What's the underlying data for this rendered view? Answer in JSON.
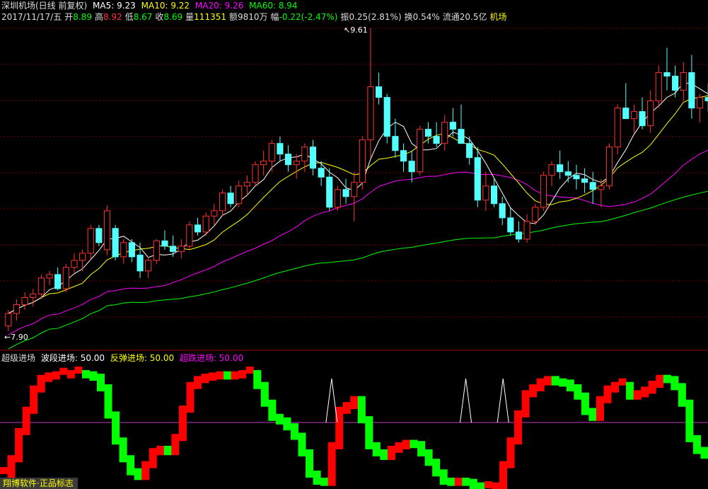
{
  "header": {
    "stock_name": "深圳机场(日线 前复权)",
    "ma5": "MA5: 9.23",
    "ma10": "MA10: 9.22",
    "ma20": "MA20: 9.26",
    "ma60": "MA60: 8.94",
    "date": "2017/11/17/五",
    "open_label": "开",
    "open": "8.89",
    "high_label": "高",
    "high": "8.92",
    "low_label": "低",
    "low": "8.67",
    "close_label": "收",
    "close": "8.69",
    "volume_label": "量",
    "volume": "111351",
    "amount_label": "额",
    "amount": "9810万",
    "change_label": "幅",
    "change": "-0.22(-2.47%)",
    "amplitude": "振0.25(2.81%)",
    "turnover": "换0.54%",
    "float_cap": "流通20.5亿",
    "sector": "机场"
  },
  "markers": {
    "high_mark": "9.61",
    "low_mark": "7.90"
  },
  "indicator": {
    "name": "超级进场",
    "wave_label": "波段进场: 50.00",
    "rebound_label": "反弹进场: 50.00",
    "superfall_label": "超跌进场: 50.00"
  },
  "brand": "翔博软件·正品标志",
  "colors": {
    "up": "#ff3232",
    "down": "#54ffff",
    "ma5": "#ffffff",
    "ma10": "#ffff00",
    "ma20": "#ff00ff",
    "ma60": "#00ff00",
    "ind_up": "#ff0000",
    "ind_down": "#00ff00"
  },
  "chart_data": {
    "type": "candlestick",
    "ylim": [
      7.9,
      9.61
    ],
    "candles": [
      [
        7.93,
        8.02,
        7.9,
        8.0
      ],
      [
        8.0,
        8.08,
        7.96,
        8.05
      ],
      [
        8.05,
        8.12,
        8.02,
        8.09
      ],
      [
        8.09,
        8.14,
        8.04,
        8.11
      ],
      [
        8.11,
        8.22,
        8.08,
        8.2
      ],
      [
        8.2,
        8.24,
        8.16,
        8.22
      ],
      [
        8.22,
        8.26,
        8.13,
        8.14
      ],
      [
        8.14,
        8.28,
        8.12,
        8.26
      ],
      [
        8.26,
        8.34,
        8.22,
        8.3
      ],
      [
        8.3,
        8.36,
        8.24,
        8.34
      ],
      [
        8.34,
        8.5,
        8.3,
        8.48
      ],
      [
        8.48,
        8.5,
        8.38,
        8.4
      ],
      [
        8.36,
        8.61,
        8.33,
        8.58
      ],
      [
        8.48,
        8.5,
        8.3,
        8.32
      ],
      [
        8.32,
        8.42,
        8.28,
        8.4
      ],
      [
        8.4,
        8.42,
        8.29,
        8.32
      ],
      [
        8.33,
        8.4,
        8.2,
        8.24
      ],
      [
        8.24,
        8.32,
        8.2,
        8.3
      ],
      [
        8.3,
        8.42,
        8.28,
        8.41
      ],
      [
        8.41,
        8.47,
        8.36,
        8.38
      ],
      [
        8.38,
        8.44,
        8.32,
        8.35
      ],
      [
        8.35,
        8.42,
        8.31,
        8.38
      ],
      [
        8.38,
        8.52,
        8.36,
        8.5
      ],
      [
        8.5,
        8.54,
        8.44,
        8.46
      ],
      [
        8.46,
        8.57,
        8.44,
        8.55
      ],
      [
        8.55,
        8.62,
        8.5,
        8.58
      ],
      [
        8.58,
        8.7,
        8.55,
        8.68
      ],
      [
        8.68,
        8.72,
        8.6,
        8.62
      ],
      [
        8.62,
        8.75,
        8.6,
        8.72
      ],
      [
        8.72,
        8.78,
        8.66,
        8.74
      ],
      [
        8.74,
        8.86,
        8.72,
        8.84
      ],
      [
        8.84,
        8.92,
        8.78,
        8.86
      ],
      [
        8.86,
        8.98,
        8.8,
        8.96
      ],
      [
        8.96,
        9.0,
        8.86,
        8.9
      ],
      [
        8.9,
        8.95,
        8.8,
        8.84
      ],
      [
        8.84,
        8.9,
        8.76,
        8.86
      ],
      [
        8.86,
        8.96,
        8.8,
        8.94
      ],
      [
        8.94,
        8.98,
        8.78,
        8.82
      ],
      [
        8.82,
        8.86,
        8.72,
        8.77
      ],
      [
        8.77,
        8.82,
        8.58,
        8.6
      ],
      [
        8.6,
        8.72,
        8.58,
        8.7
      ],
      [
        8.7,
        8.76,
        8.62,
        8.66
      ],
      [
        8.66,
        8.8,
        8.52,
        8.74
      ],
      [
        8.74,
        9.0,
        8.7,
        8.98
      ],
      [
        8.98,
        9.61,
        8.88,
        9.28
      ],
      [
        9.28,
        9.36,
        9.18,
        9.22
      ],
      [
        9.22,
        9.24,
        8.96,
        9.0
      ],
      [
        9.0,
        9.1,
        8.88,
        8.92
      ],
      [
        8.92,
        8.96,
        8.8,
        8.86
      ],
      [
        8.86,
        8.92,
        8.74,
        8.8
      ],
      [
        8.8,
        9.06,
        8.78,
        9.04
      ],
      [
        9.04,
        9.08,
        8.96,
        9.0
      ],
      [
        9.0,
        9.08,
        8.94,
        8.96
      ],
      [
        8.96,
        9.12,
        8.92,
        9.08
      ],
      [
        9.08,
        9.16,
        9.0,
        9.04
      ],
      [
        9.04,
        9.18,
        9.0,
        8.96
      ],
      [
        8.96,
        9.0,
        8.84,
        8.88
      ],
      [
        8.88,
        8.94,
        8.6,
        8.64
      ],
      [
        8.64,
        8.8,
        8.58,
        8.72
      ],
      [
        8.72,
        8.76,
        8.6,
        8.62
      ],
      [
        8.62,
        8.66,
        8.5,
        8.54
      ],
      [
        8.54,
        8.6,
        8.44,
        8.46
      ],
      [
        8.46,
        8.52,
        8.4,
        8.42
      ],
      [
        8.42,
        8.56,
        8.4,
        8.52
      ],
      [
        8.52,
        8.62,
        8.5,
        8.6
      ],
      [
        8.6,
        8.8,
        8.58,
        8.78
      ],
      [
        8.78,
        8.86,
        8.72,
        8.84
      ],
      [
        8.84,
        8.92,
        8.76,
        8.8
      ],
      [
        8.8,
        8.86,
        8.74,
        8.78
      ],
      [
        8.78,
        8.84,
        8.7,
        8.76
      ],
      [
        8.76,
        8.82,
        8.68,
        8.74
      ],
      [
        8.74,
        8.8,
        8.62,
        8.7
      ],
      [
        8.7,
        8.76,
        8.6,
        8.72
      ],
      [
        8.72,
        8.96,
        8.7,
        8.94
      ],
      [
        8.94,
        9.18,
        8.9,
        9.16
      ],
      [
        9.16,
        9.3,
        9.1,
        9.1
      ],
      [
        9.1,
        9.18,
        9.02,
        9.14
      ],
      [
        9.14,
        9.22,
        9.04,
        9.06
      ],
      [
        9.06,
        9.26,
        9.02,
        9.2
      ],
      [
        9.2,
        9.4,
        9.16,
        9.36
      ],
      [
        9.36,
        9.5,
        9.26,
        9.34
      ],
      [
        9.34,
        9.4,
        9.22,
        9.26
      ],
      [
        9.26,
        9.42,
        9.2,
        9.36
      ],
      [
        9.36,
        9.46,
        9.1,
        9.16
      ],
      [
        9.16,
        9.24,
        9.08,
        9.22
      ],
      [
        9.22,
        9.3,
        9.14,
        9.2
      ]
    ],
    "indicator": [
      0.12,
      0.25,
      0.48,
      0.66,
      0.84,
      0.93,
      0.95,
      0.96,
      0.96,
      0.97,
      0.97,
      0.96,
      0.94,
      0.85,
      0.62,
      0.4,
      0.25,
      0.14,
      0.1,
      0.2,
      0.31,
      0.33,
      0.31,
      0.43,
      0.67,
      0.87,
      0.92,
      0.94,
      0.95,
      0.96,
      0.95,
      0.96,
      0.97,
      0.97,
      0.87,
      0.72,
      0.6,
      0.57,
      0.52,
      0.44,
      0.3,
      0.12,
      0.06,
      0.05,
      0.36,
      0.66,
      0.7,
      0.75,
      0.58,
      0.36,
      0.3,
      0.27,
      0.33,
      0.36,
      0.38,
      0.37,
      0.3,
      0.22,
      0.13,
      0.06,
      0.05,
      0.06,
      0.05,
      0.02,
      0.0,
      0.0,
      0.02,
      0.2,
      0.4,
      0.63,
      0.8,
      0.85,
      0.9,
      0.92,
      0.9,
      0.89,
      0.85,
      0.78,
      0.65,
      0.6,
      0.75,
      0.84,
      0.87,
      0.87,
      0.78,
      0.8,
      0.83,
      0.88,
      0.93,
      0.92,
      0.86,
      0.72,
      0.42,
      0.32,
      0.28
    ],
    "peaks": [
      44,
      62,
      67
    ]
  }
}
